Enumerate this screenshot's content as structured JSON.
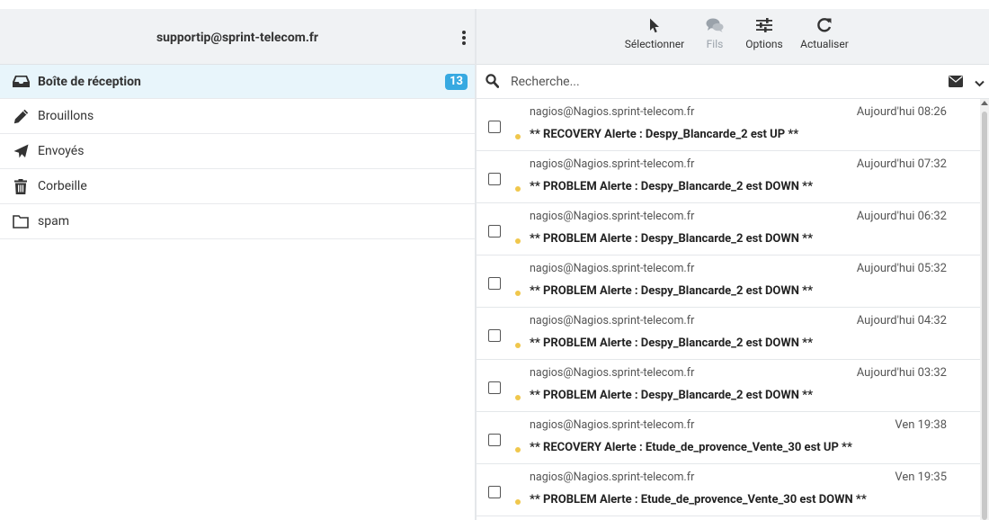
{
  "account": {
    "email": "supportip@sprint-telecom.fr"
  },
  "folders": [
    {
      "label": "Boîte de réception",
      "icon": "inbox-icon",
      "unread": "13",
      "active": true
    },
    {
      "label": "Brouillons",
      "icon": "pencil-icon"
    },
    {
      "label": "Envoyés",
      "icon": "paper-plane-icon"
    },
    {
      "label": "Corbeille",
      "icon": "trash-icon"
    },
    {
      "label": "spam",
      "icon": "folder-icon"
    }
  ],
  "toolbar": {
    "select_label": "Sélectionner",
    "threads_label": "Fils",
    "options_label": "Options",
    "refresh_label": "Actualiser"
  },
  "search": {
    "placeholder": "Recherche..."
  },
  "colors": {
    "accent": "#37a9e1",
    "unread_dot": "#f0c74c",
    "header_bg": "#f0f2f4",
    "active_folder_bg": "#e8f5fb"
  },
  "messages": [
    {
      "from": "nagios@Nagios.sprint-telecom.fr",
      "date": "Aujourd'hui 08:26",
      "subject": "** RECOVERY Alerte : Despy_Blancarde_2 est UP **"
    },
    {
      "from": "nagios@Nagios.sprint-telecom.fr",
      "date": "Aujourd'hui 07:32",
      "subject": "** PROBLEM Alerte : Despy_Blancarde_2 est DOWN **"
    },
    {
      "from": "nagios@Nagios.sprint-telecom.fr",
      "date": "Aujourd'hui 06:32",
      "subject": "** PROBLEM Alerte : Despy_Blancarde_2 est DOWN **"
    },
    {
      "from": "nagios@Nagios.sprint-telecom.fr",
      "date": "Aujourd'hui 05:32",
      "subject": "** PROBLEM Alerte : Despy_Blancarde_2 est DOWN **"
    },
    {
      "from": "nagios@Nagios.sprint-telecom.fr",
      "date": "Aujourd'hui 04:32",
      "subject": "** PROBLEM Alerte : Despy_Blancarde_2 est DOWN **"
    },
    {
      "from": "nagios@Nagios.sprint-telecom.fr",
      "date": "Aujourd'hui 03:32",
      "subject": "** PROBLEM Alerte : Despy_Blancarde_2 est DOWN **"
    },
    {
      "from": "nagios@Nagios.sprint-telecom.fr",
      "date": "Ven 19:38",
      "subject": "** RECOVERY Alerte : Etude_de_provence_Vente_30 est UP **"
    },
    {
      "from": "nagios@Nagios.sprint-telecom.fr",
      "date": "Ven 19:35",
      "subject": "** PROBLEM Alerte : Etude_de_provence_Vente_30 est DOWN **"
    }
  ]
}
